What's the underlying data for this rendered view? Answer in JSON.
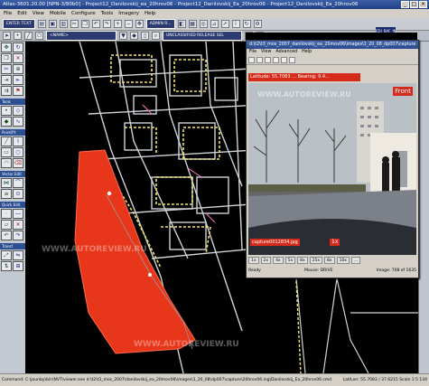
{
  "window": {
    "title": "Atlas-3601.20.00 [NPN-3/80b0] - Project12_Danilovskij_ea_20hrov06 - Project12_Danilovskij_Ea_20hrov06 - Project12_Danilovskij_Ea_20hrov06",
    "min": "_",
    "max": "□",
    "close": "×"
  },
  "menu": [
    "File",
    "Edit",
    "View",
    "Mobile",
    "Configure",
    "Tools",
    "Imagery",
    "Help"
  ],
  "toolbar": {
    "field1": "ENTER TEXT",
    "field2": "ADMIN R...",
    "field3": "<NAME>",
    "field4": "UNCLASSIFIED RELEASE SEL",
    "field5": "EDJ_RAF_IN"
  },
  "left_panel": {
    "sections": [
      "Tools",
      "Point/Pt",
      "Vector Edit",
      "Quick Edit",
      "Transf"
    ]
  },
  "video_window": {
    "title": "d:\\t2\\t3_mos_2007_danilovskij_ea_20mov06\\images\\1_20_08_dp007\\capture",
    "menu": [
      "File",
      "View",
      "Advanced",
      "Help"
    ],
    "overlay_top": "Latitude: 55.7083 ...   Bearing: 9.4...",
    "front_label": "Front",
    "capture_label": "capture0012834.jpg",
    "speed_label": "1x",
    "zoom_buttons": [
      "1x",
      "2x",
      "4x",
      "5x",
      "8x",
      "25x",
      "8x",
      "10x",
      "..."
    ],
    "status_left": "Ready",
    "status_mid": "Mouse: DRIVE",
    "status_right": "Image: 708 of 1635"
  },
  "watermarks": [
    "WWW.AUTOREVIEW.RU",
    "WWW.AUTOREVIEW.RU",
    "WWW.AUTOREVIEW.RU"
  ],
  "statusbar": {
    "left": "Command: C:\\jounby\\bin\\NVT\\viewer.exe d:\\t2\\t3_mos_2007\\danilovskij_ea_20mov06\\images\\1_20_08\\dp007\\capture\\20hrov06.ing\\Danilovskij_Ea_20hrov06.cmd",
    "right": "Lat/Lon: 55.7083 / 37.6215      Scale 1:5 134"
  },
  "colors": {
    "map_background": "#000000",
    "red_area": "#e8361a",
    "titlebar": "#2a4a90"
  }
}
